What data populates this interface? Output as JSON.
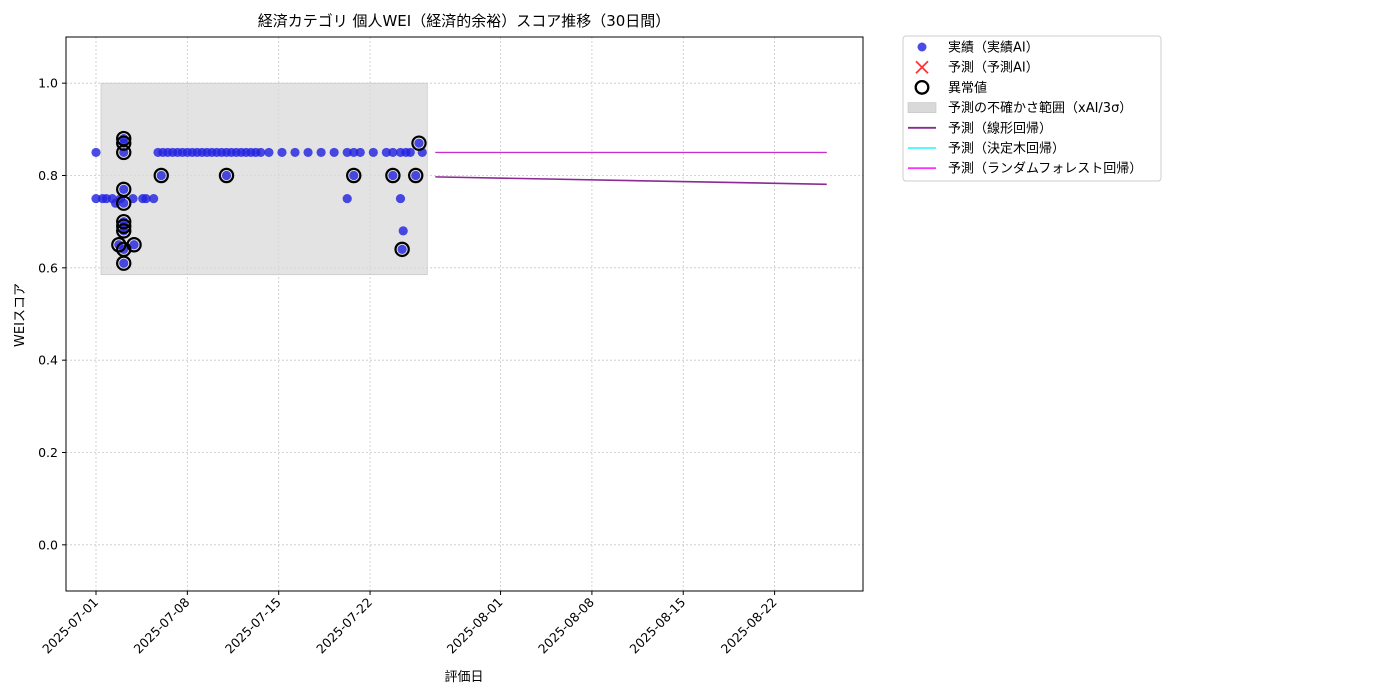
{
  "chart_data": {
    "type": "scatter",
    "title": "経済カテゴリ 個人WEI（経済的余裕）スコア推移（30日間）",
    "xlabel": "評価日",
    "ylabel": "WEIスコア",
    "xlim": [
      "2024-06-28T16:00",
      "2025-08-29T12:00"
    ],
    "ylim": [
      -0.1,
      1.1
    ],
    "x_ticks": [
      "2025-07-01",
      "2025-07-08",
      "2025-07-15",
      "2025-07-22",
      "2025-08-01",
      "2025-08-08",
      "2025-08-15",
      "2025-08-22"
    ],
    "y_ticks": [
      "0.0",
      "0.2",
      "0.4",
      "0.6",
      "0.8",
      "1.0"
    ],
    "grid": true,
    "legend_position": "outside-top-right",
    "colors": {
      "actual": "#2323e0",
      "predicted": "#ff3333",
      "anomaly": "#000000",
      "band": "#d9d9d9",
      "linear": "#8b2a96",
      "tree": "#3ff8ff",
      "forest": "#ff33ff"
    },
    "legend": [
      {
        "label": "実績（実績AI）",
        "kind": "dot"
      },
      {
        "label": "予測（予測AI）",
        "kind": "cross"
      },
      {
        "label": "異常値",
        "kind": "ring"
      },
      {
        "label": "予測の不確かさ範囲（xAI/3σ）",
        "kind": "band"
      },
      {
        "label": "予測（線形回帰）",
        "kind": "line-linear"
      },
      {
        "label": "予測（決定木回帰）",
        "kind": "line-tree"
      },
      {
        "label": "予測（ランダムフォレスト回帰）",
        "kind": "line-forest"
      }
    ],
    "uncertainty_band": {
      "x_start": "2025-07-01",
      "x_end": "2025-07-26",
      "y_low": 0.585,
      "y_high": 1.0
    },
    "series": [
      {
        "name": "実績（実績AI）",
        "points": [
          [
            "2025-07-01T00:00",
            0.85
          ],
          [
            "2025-07-01T00:00",
            0.75
          ],
          [
            "2025-07-01T12:00",
            0.75
          ],
          [
            "2025-07-01T19:00",
            0.75
          ],
          [
            "2025-07-02T06:00",
            0.75
          ],
          [
            "2025-07-02T12:00",
            0.74
          ],
          [
            "2025-07-02T21:00",
            0.75
          ],
          [
            "2025-07-03T03:00",
            0.88
          ],
          [
            "2025-07-03T03:00",
            0.87
          ],
          [
            "2025-07-03T03:00",
            0.85
          ],
          [
            "2025-07-03T03:00",
            0.77
          ],
          [
            "2025-07-03T03:00",
            0.74
          ],
          [
            "2025-07-03T03:00",
            0.7
          ],
          [
            "2025-07-03T03:00",
            0.69
          ],
          [
            "2025-07-03T03:00",
            0.68
          ],
          [
            "2025-07-03T03:00",
            0.64
          ],
          [
            "2025-07-03T03:00",
            0.61
          ],
          [
            "2025-07-02T18:00",
            0.65
          ],
          [
            "2025-07-03T22:00",
            0.65
          ],
          [
            "2025-07-03T20:00",
            0.75
          ],
          [
            "2025-07-04T14:00",
            0.75
          ],
          [
            "2025-07-04T20:00",
            0.75
          ],
          [
            "2025-07-05T10:00",
            0.75
          ],
          [
            "2025-07-05T18:00",
            0.85
          ],
          [
            "2025-07-06T00:00",
            0.8
          ],
          [
            "2025-07-06T03:00",
            0.85
          ],
          [
            "2025-07-06T12:00",
            0.85
          ],
          [
            "2025-07-06T21:00",
            0.85
          ],
          [
            "2025-07-07T06:00",
            0.85
          ],
          [
            "2025-07-07T15:00",
            0.85
          ],
          [
            "2025-07-08T00:00",
            0.85
          ],
          [
            "2025-07-08T09:00",
            0.85
          ],
          [
            "2025-07-08T18:00",
            0.85
          ],
          [
            "2025-07-09T03:00",
            0.85
          ],
          [
            "2025-07-09T12:00",
            0.85
          ],
          [
            "2025-07-09T21:00",
            0.85
          ],
          [
            "2025-07-10T06:00",
            0.85
          ],
          [
            "2025-07-10T15:00",
            0.85
          ],
          [
            "2025-07-11T00:00",
            0.85
          ],
          [
            "2025-07-11T00:00",
            0.8
          ],
          [
            "2025-07-11T09:00",
            0.85
          ],
          [
            "2025-07-11T18:00",
            0.85
          ],
          [
            "2025-07-12T03:00",
            0.85
          ],
          [
            "2025-07-12T12:00",
            0.85
          ],
          [
            "2025-07-12T21:00",
            0.85
          ],
          [
            "2025-07-13T06:00",
            0.85
          ],
          [
            "2025-07-13T15:00",
            0.85
          ],
          [
            "2025-07-14T06:00",
            0.85
          ],
          [
            "2025-07-15T06:00",
            0.85
          ],
          [
            "2025-07-16T06:00",
            0.85
          ],
          [
            "2025-07-17T06:00",
            0.85
          ],
          [
            "2025-07-18T06:00",
            0.85
          ],
          [
            "2025-07-19T06:00",
            0.85
          ],
          [
            "2025-07-20T06:00",
            0.85
          ],
          [
            "2025-07-20T06:00",
            0.75
          ],
          [
            "2025-07-20T18:00",
            0.85
          ],
          [
            "2025-07-20T18:00",
            0.8
          ],
          [
            "2025-07-21T06:00",
            0.85
          ],
          [
            "2025-07-22T06:00",
            0.85
          ],
          [
            "2025-07-23T06:00",
            0.85
          ],
          [
            "2025-07-23T18:00",
            0.85
          ],
          [
            "2025-07-23T18:00",
            0.8
          ],
          [
            "2025-07-24T08:00",
            0.85
          ],
          [
            "2025-07-24T08:00",
            0.75
          ],
          [
            "2025-07-24T13:00",
            0.68
          ],
          [
            "2025-07-24T11:00",
            0.64
          ],
          [
            "2025-07-24T18:00",
            0.85
          ],
          [
            "2025-07-25T02:00",
            0.85
          ],
          [
            "2025-07-25T12:00",
            0.8
          ],
          [
            "2025-07-25T18:00",
            0.87
          ],
          [
            "2025-07-26T00:00",
            0.85
          ]
        ]
      },
      {
        "name": "異常値",
        "points": [
          [
            "2025-07-03T03:00",
            0.88
          ],
          [
            "2025-07-03T03:00",
            0.87
          ],
          [
            "2025-07-03T03:00",
            0.85
          ],
          [
            "2025-07-03T03:00",
            0.77
          ],
          [
            "2025-07-03T03:00",
            0.74
          ],
          [
            "2025-07-03T03:00",
            0.7
          ],
          [
            "2025-07-03T03:00",
            0.69
          ],
          [
            "2025-07-03T03:00",
            0.68
          ],
          [
            "2025-07-03T03:00",
            0.64
          ],
          [
            "2025-07-03T03:00",
            0.61
          ],
          [
            "2025-07-02T18:00",
            0.65
          ],
          [
            "2025-07-03T22:00",
            0.65
          ],
          [
            "2025-07-06T00:00",
            0.8
          ],
          [
            "2025-07-11T00:00",
            0.8
          ],
          [
            "2025-07-20T18:00",
            0.8
          ],
          [
            "2025-07-23T18:00",
            0.8
          ],
          [
            "2025-07-24T11:00",
            0.64
          ],
          [
            "2025-07-25T12:00",
            0.8
          ],
          [
            "2025-07-25T18:00",
            0.87
          ]
        ]
      },
      {
        "name": "予測（線形回帰）",
        "points": [
          [
            "2025-07-27",
            0.797
          ],
          [
            "2025-08-26",
            0.781
          ]
        ]
      },
      {
        "name": "予測（ランダムフォレスト回帰）",
        "points": [
          [
            "2025-07-27",
            0.85
          ],
          [
            "2025-08-26",
            0.85
          ]
        ]
      }
    ]
  }
}
